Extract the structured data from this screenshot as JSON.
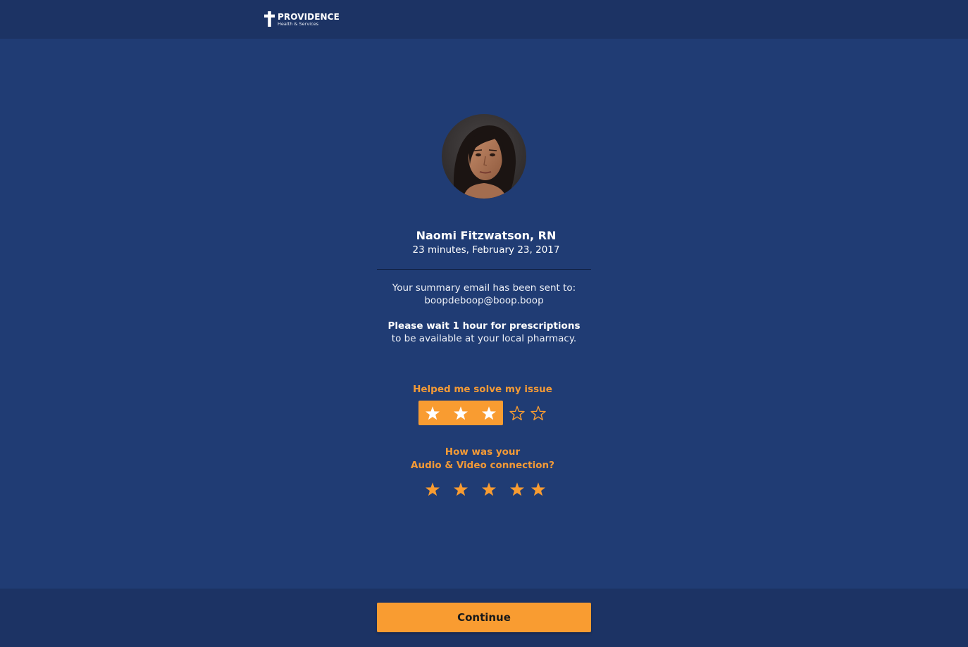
{
  "header": {
    "brand_name": "PROVIDENCE",
    "brand_sub": "Health & Services"
  },
  "provider": {
    "name": "Naomi Fitzwatson, RN",
    "visit_summary": "23 minutes, February 23, 2017",
    "avatar": "provider-photo"
  },
  "summary": {
    "email_line": "Your summary email has been sent to:",
    "email": "boopdeboop@boop.boop",
    "wait_line": "Please wait 1 hour for prescriptions",
    "pharmacy_line": "to be available at your local pharmacy."
  },
  "ratings": [
    {
      "label_lines": [
        "Helped me solve my issue"
      ],
      "value": 3,
      "max": 5
    },
    {
      "label_lines": [
        "How was your",
        "Audio & Video connection?"
      ],
      "value": 5,
      "max": 5
    }
  ],
  "footer": {
    "continue_label": "Continue"
  },
  "colors": {
    "background": "#203c74",
    "bar": "#1c3364",
    "accent": "#f99c31",
    "accent_text": "#f39a36"
  },
  "icons": {
    "logo": "cross-icon",
    "rating": "star-icon"
  }
}
